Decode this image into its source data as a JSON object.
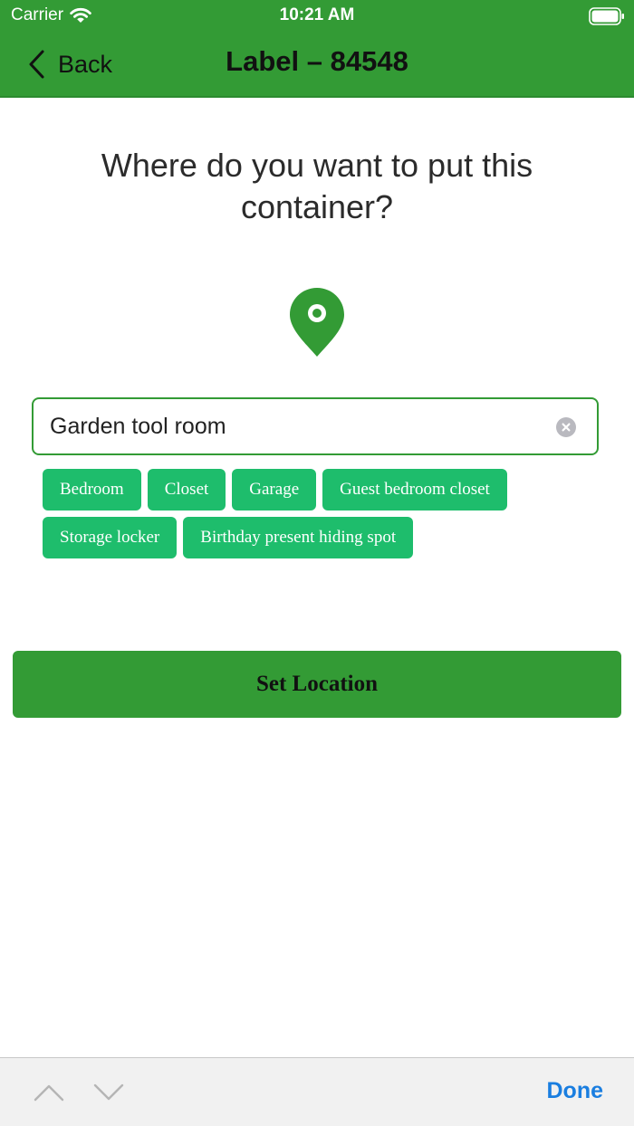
{
  "status_bar": {
    "carrier": "Carrier",
    "time": "10:21 AM",
    "icons": [
      "wifi-icon",
      "battery-icon"
    ]
  },
  "nav": {
    "back_label": "Back",
    "back_icon": "chevron-left-icon",
    "title": "Label – 84548"
  },
  "main": {
    "question": "Where do you want to put this container?",
    "pin_icon": "location-pin-icon",
    "location_input": {
      "value": "Garden tool room",
      "clear_icon": "clear-icon"
    },
    "suggestions": [
      [
        "Bedroom",
        "Closet",
        "Garage",
        "Guest bedroom closet"
      ],
      [
        "Storage locker",
        "Birthday present hiding spot"
      ]
    ],
    "submit_label": "Set Location"
  },
  "accessory": {
    "prev_icon": "chevron-up-icon",
    "next_icon": "chevron-down-icon",
    "done_label": "Done"
  },
  "colors": {
    "brand_green": "#339b35",
    "chip_green": "#1ebd6c",
    "done_blue": "#1a7ee0"
  }
}
